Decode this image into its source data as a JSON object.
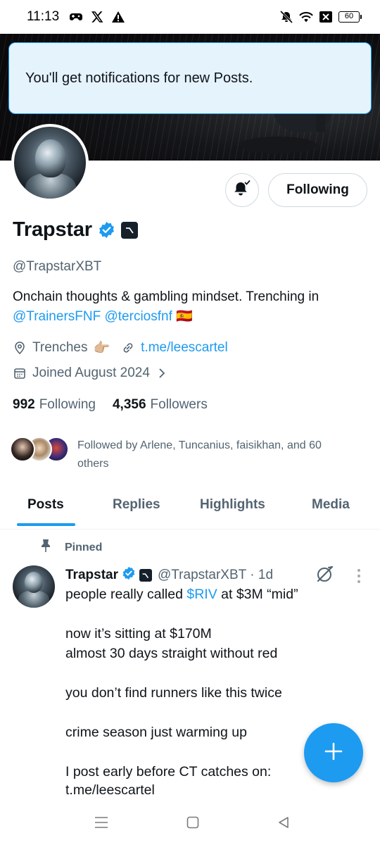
{
  "status_bar": {
    "time": "11:13",
    "battery": "60"
  },
  "toast": {
    "message": "You'll get notifications for new Posts."
  },
  "profile": {
    "following_button": "Following",
    "display_name": "Trapstar",
    "handle": "@TrapstarXBT",
    "bio_line1": "Onchain thoughts & gambling mindset.  Trenching in",
    "bio_mention1": "@TrainersFNF",
    "bio_mention2": "@terciosfnf",
    "bio_flag": "🇪🇸",
    "location": "Trenches",
    "location_emoji": "👉🏼",
    "website": "t.me/leescartel",
    "joined": "Joined August 2024",
    "following_count": "992",
    "following_label": "Following",
    "followers_count": "4,356",
    "followers_label": "Followers",
    "followed_by_line1": "Followed by Arlene, Tuncanius, faisikhan, and 60",
    "followed_by_line2": "others"
  },
  "tabs": [
    {
      "label": "Posts",
      "active": true
    },
    {
      "label": "Replies",
      "active": false
    },
    {
      "label": "Highlights",
      "active": false
    },
    {
      "label": "Media",
      "active": false
    }
  ],
  "post": {
    "pinned_label": "Pinned",
    "author_name": "Trapstar",
    "author_handle": "@TrapstarXBT",
    "time": "· 1d",
    "line1_before": "people really called ",
    "line1_cashtag": "$RIV",
    "line1_after": " at $3M “mid”",
    "line2": "now it’s sitting at $170M",
    "line3": "almost 30 days straight without red",
    "line4": "you don’t find runners like this twice",
    "line5": "crime season just warming up",
    "line6": "I post early before CT catches on:",
    "line7_link": "t.me/leescartel"
  },
  "colors": {
    "accent": "#1d9bf0",
    "text_primary": "#0f1419",
    "text_secondary": "#536471",
    "toast_bg": "#e5f3fd"
  }
}
